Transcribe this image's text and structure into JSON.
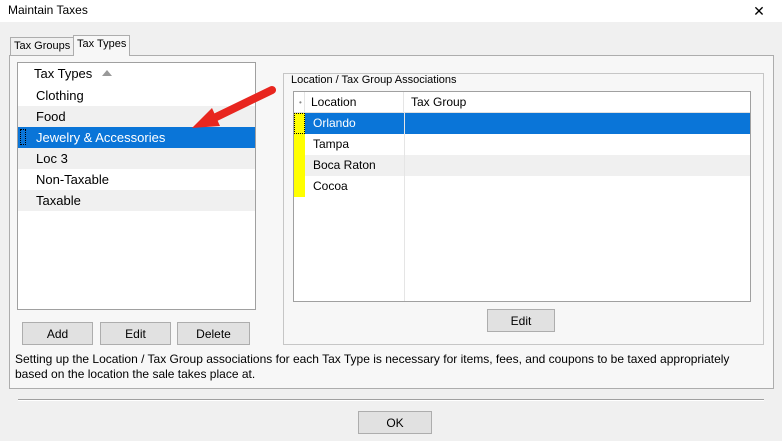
{
  "window": {
    "title": "Maintain Taxes",
    "close_glyph": "✕"
  },
  "tabs": [
    {
      "label": "Tax Groups"
    },
    {
      "label": "Tax Types",
      "active": true
    }
  ],
  "tax_types": {
    "header": "Tax Types",
    "items": [
      {
        "label": "Clothing"
      },
      {
        "label": "Food"
      },
      {
        "label": "Jewelry & Accessories",
        "selected": true
      },
      {
        "label": "Loc 3"
      },
      {
        "label": "Non-Taxable"
      },
      {
        "label": "Taxable"
      }
    ],
    "buttons": {
      "add": "Add",
      "edit": "Edit",
      "delete": "Delete"
    }
  },
  "associations": {
    "group_label": "Location / Tax Group Associations",
    "columns": [
      "Location",
      "Tax Group"
    ],
    "rows": [
      {
        "location": "Orlando",
        "tax_group": ""
      },
      {
        "location": "Tampa",
        "tax_group": ""
      },
      {
        "location": "Boca Raton",
        "tax_group": ""
      },
      {
        "location": "Cocoa",
        "tax_group": ""
      }
    ],
    "edit_button": "Edit"
  },
  "info_text": "Setting up the Location / Tax Group associations for each Tax Type is necessary for items, fees, and coupons to be taxed appropriately based on the location the sale takes place at.",
  "ok_button": "OK",
  "colors": {
    "selection": "#0a75d8",
    "row_indicator": "#ffff00",
    "annotation_arrow": "#e8261f"
  }
}
